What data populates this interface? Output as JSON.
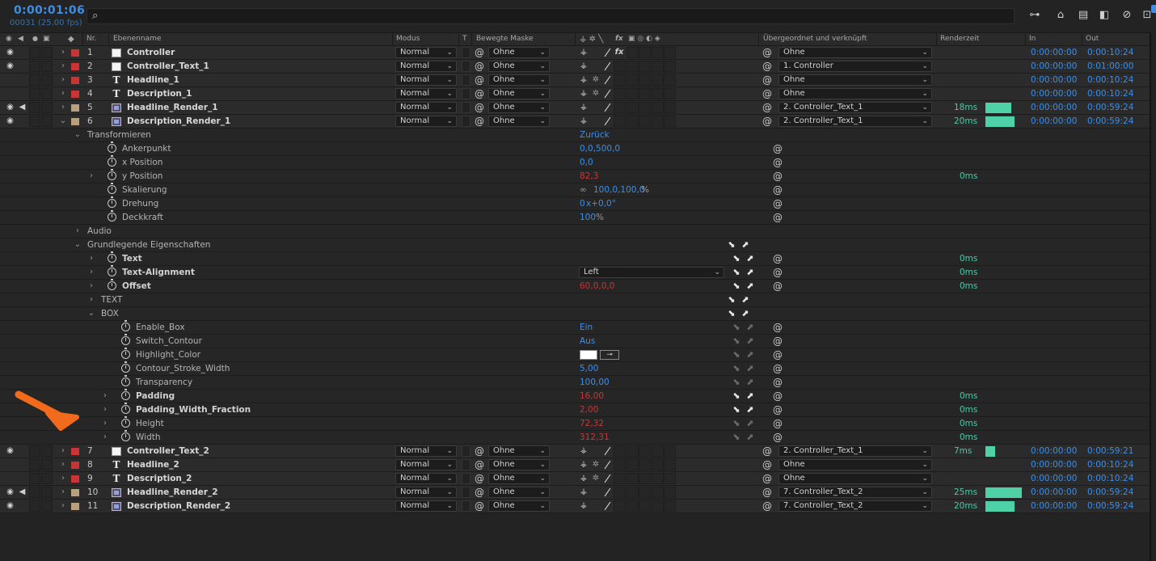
{
  "topbar": {
    "timecode": "0:00:01:06",
    "framecount": "00031 (25.00 fps)",
    "search_icon": "search-icon",
    "icons": [
      "tree-icon",
      "composition-icon",
      "stack-icon",
      "layers-icon",
      "graph-icon",
      "frame-icon"
    ]
  },
  "columns": {
    "nr": "Nr.",
    "layer_name": "Ebenenname",
    "mode": "Modus",
    "t": "T",
    "track_matte": "Bewegte Maske",
    "parent": "Übergeordnet und verknüpft",
    "render_time": "Renderzeit",
    "in": "In",
    "out": "Out",
    "fx": "fx"
  },
  "layers_top": [
    {
      "num": "1",
      "name": "Controller",
      "type": "solid",
      "label_color": "#c93434",
      "eye": true,
      "audio": false,
      "mode": "Normal",
      "matte": "Ohne",
      "parent": "Ohne",
      "render": "",
      "bar": 0,
      "in": "0:00:00:00",
      "out": "0:00:10:24",
      "twirl": "›",
      "fx": true
    },
    {
      "num": "2",
      "name": "Controller_Text_1",
      "type": "solid",
      "label_color": "#c93434",
      "eye": true,
      "audio": false,
      "mode": "Normal",
      "matte": "Ohne",
      "parent": "1. Controller",
      "render": "",
      "bar": 0,
      "in": "0:00:00:00",
      "out": "0:01:00:00",
      "twirl": "›",
      "fx": false
    },
    {
      "num": "3",
      "name": "Headline_1",
      "type": "text",
      "label_color": "#c93434",
      "eye": false,
      "audio": false,
      "mode": "Normal",
      "matte": "Ohne",
      "parent": "Ohne",
      "render": "",
      "bar": 0,
      "in": "0:00:00:00",
      "out": "0:00:10:24",
      "twirl": "›",
      "fx": false
    },
    {
      "num": "4",
      "name": "Description_1",
      "type": "text",
      "label_color": "#c93434",
      "eye": false,
      "audio": false,
      "mode": "Normal",
      "matte": "Ohne",
      "parent": "Ohne",
      "render": "",
      "bar": 0,
      "in": "0:00:00:00",
      "out": "0:00:10:24",
      "twirl": "›",
      "fx": false
    },
    {
      "num": "5",
      "name": "Headline_Render_1",
      "type": "comp",
      "label_color": "#b8a07a",
      "eye": true,
      "audio": true,
      "mode": "Normal",
      "matte": "Ohne",
      "parent": "2. Controller_Text_1",
      "render": "18ms",
      "bar": 32,
      "in": "0:00:00:00",
      "out": "0:00:59:24",
      "twirl": "›",
      "fx": false
    },
    {
      "num": "6",
      "name": "Description_Render_1",
      "type": "comp",
      "label_color": "#b8a07a",
      "eye": true,
      "audio": false,
      "mode": "Normal",
      "matte": "Ohne",
      "parent": "2. Controller_Text_1",
      "render": "20ms",
      "bar": 36,
      "in": "0:00:00:00",
      "out": "0:00:59:24",
      "twirl": "⌄",
      "fx": false
    }
  ],
  "properties": [
    {
      "indent": 0,
      "twirl": "⌄",
      "name": "Transformieren",
      "bold": false,
      "stopwatch": false,
      "value": "Zurück",
      "value_class": "",
      "spiral": false,
      "picks": "",
      "render": ""
    },
    {
      "indent": 1,
      "twirl": "",
      "name": "Ankerpunkt",
      "bold": false,
      "stopwatch": true,
      "value": "0,0,500,0",
      "value_class": "",
      "spiral": true,
      "picks": "",
      "render": ""
    },
    {
      "indent": 1,
      "twirl": "",
      "name": "x Position",
      "bold": false,
      "stopwatch": true,
      "value": "0,0",
      "value_class": "",
      "spiral": true,
      "picks": "",
      "render": ""
    },
    {
      "indent": 1,
      "twirl": "›",
      "name": "y Position",
      "bold": false,
      "stopwatch": true,
      "value": "82,3",
      "value_class": "red",
      "spiral": true,
      "picks": "",
      "render": "0ms"
    },
    {
      "indent": 1,
      "twirl": "",
      "name": "Skalierung",
      "bold": false,
      "stopwatch": true,
      "value": "100,0,100,0",
      "value_class": "",
      "link": true,
      "unit": "%",
      "spiral": true,
      "picks": "",
      "render": ""
    },
    {
      "indent": 1,
      "twirl": "",
      "name": "Drehung",
      "bold": false,
      "stopwatch": true,
      "value": "0",
      "value_class": "",
      "extra": "x+0,0°",
      "spiral": true,
      "picks": "",
      "render": ""
    },
    {
      "indent": 1,
      "twirl": "",
      "name": "Deckkraft",
      "bold": false,
      "stopwatch": true,
      "value": "100",
      "value_class": "",
      "unit": "%",
      "spiral": true,
      "picks": "",
      "render": ""
    },
    {
      "indent": 0,
      "twirl": "›",
      "name": "Audio",
      "bold": false,
      "stopwatch": false,
      "value": "",
      "value_class": "",
      "spiral": false,
      "picks": "",
      "render": ""
    },
    {
      "indent": 0,
      "twirl": "⌄",
      "name": "Grundlegende Eigenschaften",
      "bold": false,
      "stopwatch": false,
      "value": "",
      "value_class": "",
      "spiral": false,
      "picks": "hdr",
      "render": ""
    },
    {
      "indent": 1,
      "twirl": "›",
      "name": "Text",
      "bold": true,
      "stopwatch": true,
      "value": "",
      "value_class": "",
      "spiral": true,
      "picks": "on",
      "render": "0ms"
    },
    {
      "indent": 1,
      "twirl": "›",
      "name": "Text-Alignment",
      "bold": true,
      "stopwatch": true,
      "value": "",
      "value_class": "",
      "dropdown": "Left",
      "spiral": true,
      "picks": "on",
      "render": "0ms"
    },
    {
      "indent": 1,
      "twirl": "›",
      "name": "Offset",
      "bold": true,
      "stopwatch": true,
      "value": "60,0,0,0",
      "value_class": "red",
      "spiral": true,
      "picks": "on",
      "render": "0ms"
    },
    {
      "indent": 1,
      "twirl": "›",
      "name": "TEXT",
      "bold": false,
      "stopwatch": false,
      "value": "",
      "value_class": "",
      "spiral": false,
      "picks": "hdr",
      "render": ""
    },
    {
      "indent": 1,
      "twirl": "⌄",
      "name": "BOX",
      "bold": false,
      "stopwatch": false,
      "value": "",
      "value_class": "",
      "spiral": false,
      "picks": "hdr",
      "render": ""
    },
    {
      "indent": 2,
      "twirl": "",
      "name": "Enable_Box",
      "bold": false,
      "stopwatch": true,
      "value": "Ein",
      "value_class": "",
      "spiral": true,
      "picks": "dim",
      "render": ""
    },
    {
      "indent": 2,
      "twirl": "",
      "name": "Switch_Contour",
      "bold": false,
      "stopwatch": true,
      "value": "Aus",
      "value_class": "",
      "spiral": true,
      "picks": "dim",
      "render": ""
    },
    {
      "indent": 2,
      "twirl": "",
      "name": "Highlight_Color",
      "bold": false,
      "stopwatch": true,
      "value": "",
      "value_class": "",
      "color_swatch": "#ffffff",
      "spiral": true,
      "picks": "dim",
      "render": ""
    },
    {
      "indent": 2,
      "twirl": "",
      "name": "Contour_Stroke_Width",
      "bold": false,
      "stopwatch": true,
      "value": "5,00",
      "value_class": "",
      "spiral": true,
      "picks": "dim",
      "render": ""
    },
    {
      "indent": 2,
      "twirl": "",
      "name": "Transparency",
      "bold": false,
      "stopwatch": true,
      "value": "100,00",
      "value_class": "",
      "spiral": true,
      "picks": "dim",
      "render": ""
    },
    {
      "indent": 2,
      "twirl": "›",
      "name": "Padding",
      "bold": true,
      "stopwatch": true,
      "value": "16,00",
      "value_class": "red",
      "spiral": true,
      "picks": "on",
      "render": "0ms"
    },
    {
      "indent": 2,
      "twirl": "›",
      "name": "Padding_Width_Fraction",
      "bold": true,
      "stopwatch": true,
      "value": "2,00",
      "value_class": "red",
      "spiral": true,
      "picks": "on",
      "render": "0ms"
    },
    {
      "indent": 2,
      "twirl": "›",
      "name": "Height",
      "bold": false,
      "stopwatch": true,
      "value": "72,32",
      "value_class": "red",
      "spiral": true,
      "picks": "dim",
      "render": "0ms"
    },
    {
      "indent": 2,
      "twirl": "›",
      "name": "Width",
      "bold": false,
      "stopwatch": true,
      "value": "312,31",
      "value_class": "red",
      "spiral": true,
      "picks": "dim",
      "render": "0ms"
    }
  ],
  "layers_bottom": [
    {
      "num": "7",
      "name": "Controller_Text_2",
      "type": "solid",
      "label_color": "#c93434",
      "eye": true,
      "audio": false,
      "mode": "Normal",
      "matte": "Ohne",
      "parent": "2. Controller_Text_1",
      "render": "7ms",
      "bar": 12,
      "in": "0:00:00:00",
      "out": "0:00:59:21",
      "twirl": "›",
      "fx": false
    },
    {
      "num": "8",
      "name": "Headline_2",
      "type": "text",
      "label_color": "#c93434",
      "eye": false,
      "audio": false,
      "mode": "Normal",
      "matte": "Ohne",
      "parent": "Ohne",
      "render": "",
      "bar": 0,
      "in": "0:00:00:00",
      "out": "0:00:10:24",
      "twirl": "›",
      "fx": false
    },
    {
      "num": "9",
      "name": "Description_2",
      "type": "text",
      "label_color": "#c93434",
      "eye": false,
      "audio": false,
      "mode": "Normal",
      "matte": "Ohne",
      "parent": "Ohne",
      "render": "",
      "bar": 0,
      "in": "0:00:00:00",
      "out": "0:00:10:24",
      "twirl": "›",
      "fx": false
    },
    {
      "num": "10",
      "name": "Headline_Render_2",
      "type": "comp",
      "label_color": "#b8a07a",
      "eye": true,
      "audio": true,
      "mode": "Normal",
      "matte": "Ohne",
      "parent": "7. Controller_Text_2",
      "render": "25ms",
      "bar": 45,
      "in": "0:00:00:00",
      "out": "0:00:59:24",
      "twirl": "›",
      "fx": false
    },
    {
      "num": "11",
      "name": "Description_Render_2",
      "type": "comp",
      "label_color": "#b8a07a",
      "eye": true,
      "audio": false,
      "mode": "Normal",
      "matte": "Ohne",
      "parent": "7. Controller_Text_2",
      "render": "20ms",
      "bar": 36,
      "in": "0:00:00:00",
      "out": "0:00:59:24",
      "twirl": "›",
      "fx": false
    }
  ],
  "annotation": {
    "arrow_color": "#f26a1b"
  }
}
